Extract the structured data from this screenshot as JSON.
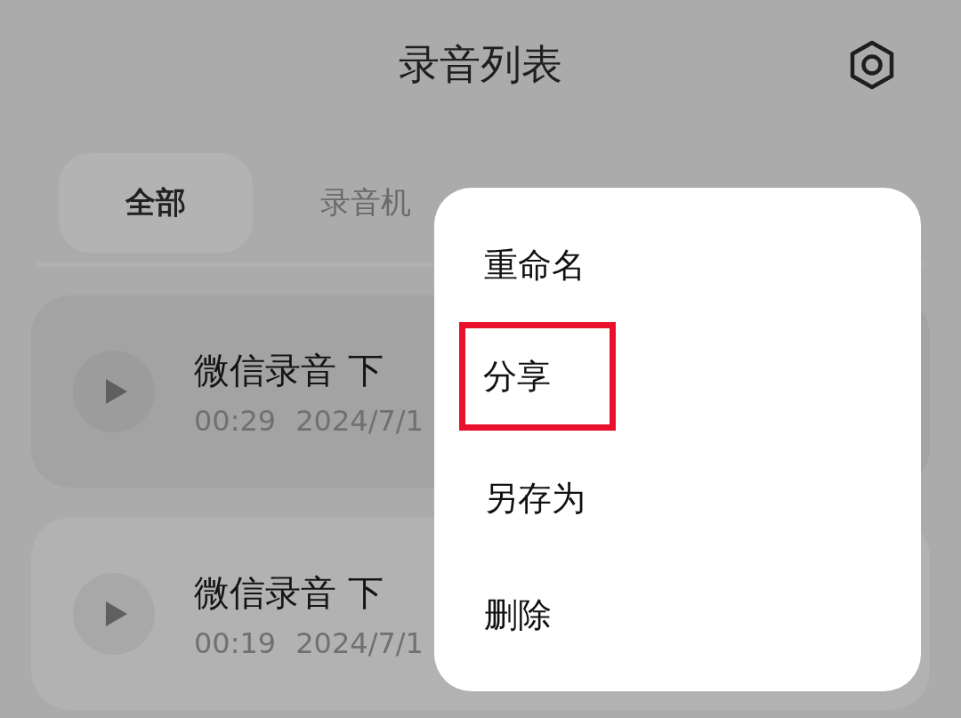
{
  "header": {
    "title": "录音列表"
  },
  "tabs": [
    {
      "label": "全部",
      "selected": true
    },
    {
      "label": "录音机",
      "selected": false
    }
  ],
  "recordings": [
    {
      "title": "微信录音 下",
      "duration": "00:29",
      "date": "2024/7/1",
      "selected": true
    },
    {
      "title": "微信录音 下",
      "duration": "00:19",
      "date": "2024/7/1",
      "selected": false
    }
  ],
  "context_menu": {
    "items": [
      {
        "label": "重命名",
        "highlighted": false
      },
      {
        "label": "分享",
        "highlighted": true
      },
      {
        "label": "另存为",
        "highlighted": false
      },
      {
        "label": "删除",
        "highlighted": false
      }
    ]
  }
}
